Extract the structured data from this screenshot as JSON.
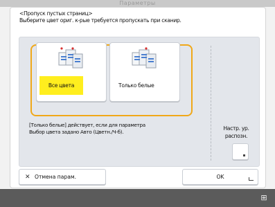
{
  "titlebar": {
    "title": "Параметры"
  },
  "header": {
    "line1": "<Пропуск пустых страниц>",
    "line2": "Выберите цвет ориг. к-рые требуется пропускать при сканир."
  },
  "options": [
    {
      "label": "Все цвета",
      "selected": true,
      "icon": "color-pages-icon"
    },
    {
      "label": "Только белые",
      "selected": false,
      "icon": "white-pages-icon"
    }
  ],
  "note": {
    "line1": "[Только белые] действует, если для параметра",
    "line2": "Выбор цвета задано Авто (Цветн./Ч-б)."
  },
  "distance": {
    "label_line1": "Настр. ур.",
    "label_line2": "распозн."
  },
  "buttons": {
    "cancel": "Отмена парам.",
    "ok": "OK"
  },
  "colors": {
    "accent": "#f0a818",
    "selected_fill": "#ffee1e"
  }
}
